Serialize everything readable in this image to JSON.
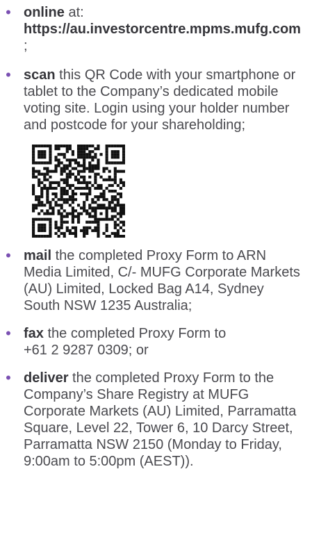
{
  "colors": {
    "bullet": "#7a4fb2",
    "text": "#4a4a4f",
    "keyword": "#35353a",
    "qr": "#111111"
  },
  "items": [
    {
      "keyword": "online",
      "pre": " at: ",
      "strong": "https://au.investorcentre.mpms.mufg.com",
      "post": ";"
    },
    {
      "keyword": "scan",
      "text": " this QR Code with your smartphone or tablet to the Company’s dedicated mobile voting site. Login using your holder number and postcode for your shareholding;"
    },
    {
      "keyword": "mail",
      "text": " the completed Proxy Form to ARN Media Limited, C/- MUFG Corporate Markets (AU) Limited, Locked Bag A14, Sydney South NSW 1235 Australia;"
    },
    {
      "keyword": "fax",
      "text": " the completed Proxy Form to +61 2 9287 0309; or"
    },
    {
      "keyword": "deliver",
      "text": " the completed Proxy Form to the Company’s Share Registry at MUFG Corporate Markets (AU) Limited, Parramatta Square, Level 22, Tower 6, 10 Darcy Street, Parramatta NSW 2150 (Monday to Friday, 9:00am to 5:00pm (AEST))."
    }
  ],
  "bullet_glyph": "•",
  "qr_icon": "qr-code-icon"
}
